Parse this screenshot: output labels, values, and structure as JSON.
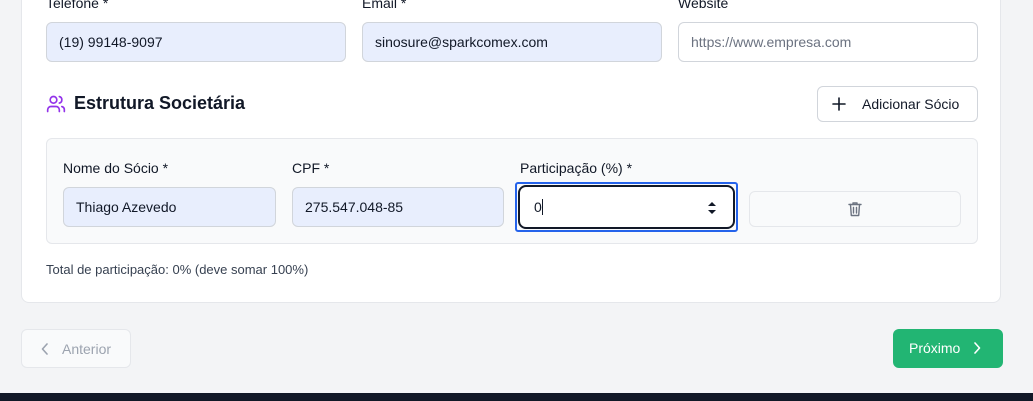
{
  "contact": {
    "phone_label": "Telefone *",
    "phone_value": "(19) 99148-9097",
    "email_label": "Email *",
    "email_value": "sinosure@sparkcomex.com",
    "website_label": "Website",
    "website_placeholder": "https://www.empresa.com"
  },
  "section": {
    "title": "Estrutura Societária",
    "icon": "users-icon",
    "add_button": "Adicionar Sócio"
  },
  "partner": {
    "name_label": "Nome do Sócio *",
    "name_value": "Thiago Azevedo",
    "cpf_label": "CPF *",
    "cpf_value": "275.547.048-85",
    "participation_label": "Participação (%) *",
    "participation_value": "0",
    "remove_icon": "trash-icon"
  },
  "total_text": "Total de participação: 0% (deve somar 100%)",
  "nav": {
    "prev_label": "Anterior",
    "next_label": "Próximo"
  },
  "colors": {
    "accent": "#22b573",
    "focus": "#2563eb",
    "section_icon": "#9333ea",
    "filled_field": "#e8eefd"
  }
}
